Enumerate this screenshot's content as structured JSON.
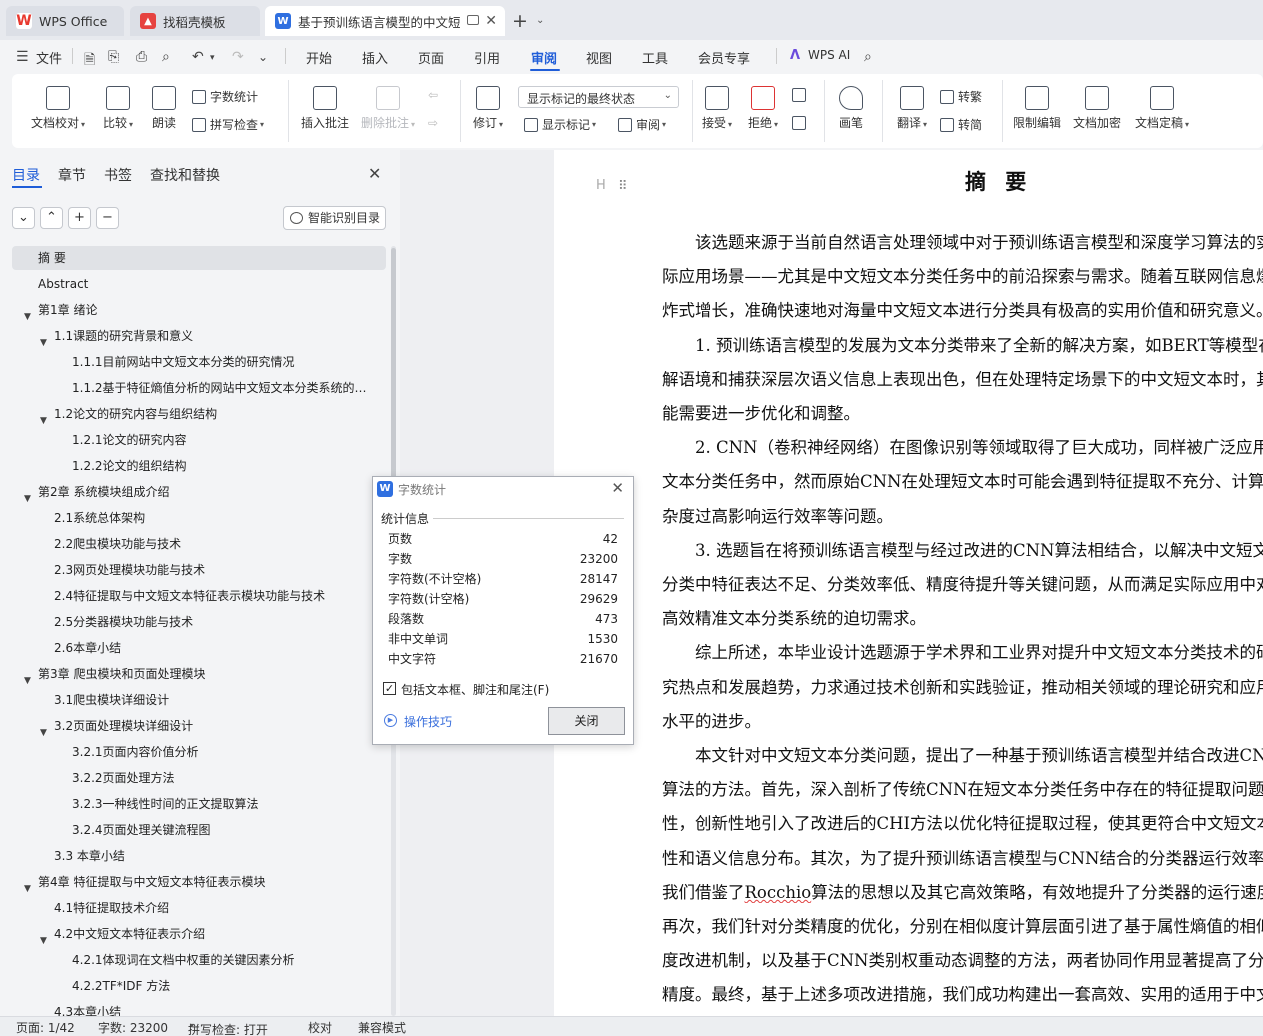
{
  "tabs": [
    {
      "label": "WPS Office",
      "icon": "wps-logo-icon"
    },
    {
      "label": "找稻壳模板",
      "icon": "docer-icon"
    },
    {
      "label": "基于预训练语言模型的中文短",
      "icon": "word-doc-icon"
    }
  ],
  "menu": {
    "file": "文件",
    "items": [
      "开始",
      "插入",
      "页面",
      "引用",
      "审阅",
      "视图",
      "工具",
      "会员专享"
    ],
    "active": "审阅",
    "ai": "WPS AI"
  },
  "ribbon": {
    "doc_check": "文档校对",
    "compare": "比较",
    "read_aloud": "朗读",
    "word_count": "字数统计",
    "spell_check": "拼写检查",
    "insert_comment": "插入批注",
    "delete_comment": "删除批注",
    "revise": "修订",
    "markup_state": "显示标记的最终状态",
    "show_markup": "显示标记",
    "review": "审阅",
    "accept": "接受",
    "reject": "拒绝",
    "pen": "画笔",
    "translate": "翻译",
    "to_traditional": "转繁",
    "to_simplified": "转简",
    "restrict_edit": "限制编辑",
    "encrypt": "文档加密",
    "finalize": "文档定稿"
  },
  "nav": {
    "tabs": [
      "目录",
      "章节",
      "书签",
      "查找和替换"
    ],
    "smart_toc": "智能识别目录",
    "toc": [
      {
        "label": "摘  要",
        "level": 0,
        "arrow": false,
        "selected": true
      },
      {
        "label": "Abstract",
        "level": 0,
        "arrow": false
      },
      {
        "label": "第1章  绪论",
        "level": 0,
        "arrow": true
      },
      {
        "label": "1.1课题的研究背景和意义",
        "level": 1,
        "arrow": true
      },
      {
        "label": "1.1.1目前网站中文短文本分类的研究情况",
        "level": 2,
        "arrow": false
      },
      {
        "label": "1.1.2基于特征熵值分析的网站中文短文本分类系统的设…",
        "level": 2,
        "arrow": false
      },
      {
        "label": "1.2论文的研究内容与组织结构",
        "level": 1,
        "arrow": true
      },
      {
        "label": "1.2.1论文的研究内容",
        "level": 2,
        "arrow": false
      },
      {
        "label": "1.2.2论文的组织结构",
        "level": 2,
        "arrow": false
      },
      {
        "label": "第2章  系统模块组成介绍",
        "level": 0,
        "arrow": true
      },
      {
        "label": "2.1系统总体架构",
        "level": 1,
        "arrow": false
      },
      {
        "label": "2.2爬虫模块功能与技术",
        "level": 1,
        "arrow": false
      },
      {
        "label": "2.3网页处理模块功能与技术",
        "level": 1,
        "arrow": false
      },
      {
        "label": "2.4特征提取与中文短文本特征表示模块功能与技术",
        "level": 1,
        "arrow": false
      },
      {
        "label": "2.5分类器模块功能与技术",
        "level": 1,
        "arrow": false
      },
      {
        "label": "2.6本章小结",
        "level": 1,
        "arrow": false
      },
      {
        "label": "第3章  爬虫模块和页面处理模块",
        "level": 0,
        "arrow": true
      },
      {
        "label": "3.1爬虫模块详细设计",
        "level": 1,
        "arrow": false
      },
      {
        "label": "3.2页面处理模块详细设计",
        "level": 1,
        "arrow": true
      },
      {
        "label": "3.2.1页面内容价值分析",
        "level": 2,
        "arrow": false
      },
      {
        "label": "3.2.2页面处理方法",
        "level": 2,
        "arrow": false
      },
      {
        "label": "3.2.3一种线性时间的正文提取算法",
        "level": 2,
        "arrow": false
      },
      {
        "label": "3.2.4页面处理关键流程图",
        "level": 2,
        "arrow": false
      },
      {
        "label": "3.3 本章小结",
        "level": 1,
        "arrow": false
      },
      {
        "label": "第4章  特征提取与中文短文本特征表示模块",
        "level": 0,
        "arrow": true
      },
      {
        "label": "4.1特征提取技术介绍",
        "level": 1,
        "arrow": false
      },
      {
        "label": "4.2中文短文本特征表示介绍",
        "level": 1,
        "arrow": true
      },
      {
        "label": "4.2.1体现词在文档中权重的关键因素分析",
        "level": 2,
        "arrow": false
      },
      {
        "label": "4.2.2TF*IDF 方法",
        "level": 2,
        "arrow": false
      },
      {
        "label": "4.3本章小结",
        "level": 1,
        "arrow": false
      }
    ]
  },
  "document": {
    "heading_marker": "H",
    "title": "摘  要",
    "lines": [
      "　　该选题来源于当前自然语言处理领域中对于预训练语言模型和深度学习算法的实",
      "际应用场景——尤其是中文短文本分类任务中的前沿探索与需求。随着互联网信息爆",
      "炸式增长，准确快速地对海量中文短文本进行分类具有极高的实用价值和研究意义。",
      "　　1. 预训练语言模型的发展为文本分类带来了全新的解决方案，如BERT等模型在理",
      "解语境和捕获深层次语义信息上表现出色，但在处理特定场景下的中文短文本时，其性",
      "能需要进一步优化和调整。",
      "　　2. CNN（卷积神经网络）在图像识别等领域取得了巨大成功，同样被广泛应用到",
      "文本分类任务中，然而原始CNN在处理短文本时可能会遇到特征提取不充分、计算复",
      "杂度过高影响运行效率等问题。",
      "　　3. 选题旨在将预训练语言模型与经过改进的CNN算法相结合，以解决中文短文本",
      "分类中特征表达不足、分类效率低、精度待提升等关键问题，从而满足实际应用中对于",
      "高效精准文本分类系统的迫切需求。",
      "　　综上所述，本毕业设计选题源于学术界和工业界对提升中文短文本分类技术的研",
      "究热点和发展趋势，力求通过技术创新和实践验证，推动相关领域的理论研究和应用",
      "水平的进步。",
      "　　本文针对中文短文本分类问题，提出了一种基于预训练语言模型并结合改进CNN",
      "算法的方法。首先，深入剖析了传统CNN在短文本分类任务中存在的特征提取问题，",
      "性，创新性地引入了改进后的CHI方法以优化特征提取过程，使其更符合中文短文本特",
      "性和语义信息分布。其次，为了提升预训练语言模型与CNN结合的分类器运行效率，",
      "我们借鉴了Rocchio算法的思想以及其它高效策略，有效地提升了分类器的运行速度。",
      "再次，我们针对分类精度的优化，分别在相似度计算层面引进了基于属性熵值的相似",
      "度改进机制，以及基于CNN类别权重动态调整的方法，两者协同作用显著提高了分类",
      "精度。最终，基于上述多项改进措施，我们成功构建出一套高效、实用的适用于中文"
    ]
  },
  "dialog": {
    "title": "字数统计",
    "group": "统计信息",
    "stats": [
      {
        "label": "页数",
        "value": "42"
      },
      {
        "label": "字数",
        "value": "23200"
      },
      {
        "label": "字符数(不计空格)",
        "value": "28147"
      },
      {
        "label": "字符数(计空格)",
        "value": "29629"
      },
      {
        "label": "段落数",
        "value": "473"
      },
      {
        "label": "非中文单词",
        "value": "1530"
      },
      {
        "label": "中文字符",
        "value": "21670"
      }
    ],
    "checkbox_label": "包括文本框、脚注和尾注(F)",
    "checkbox_checked": true,
    "tips": "操作技巧",
    "close": "关闭"
  },
  "status": {
    "page": "页面: 1/42",
    "words": "字数: 23200",
    "spell": "拼写检查: 打开",
    "proof": "校对",
    "compat": "兼容模式"
  },
  "colors": {
    "accent": "#1f5dd8",
    "wps_red": "#e8392f",
    "docer_red": "#e64340",
    "word_blue": "#2f6fe0"
  }
}
